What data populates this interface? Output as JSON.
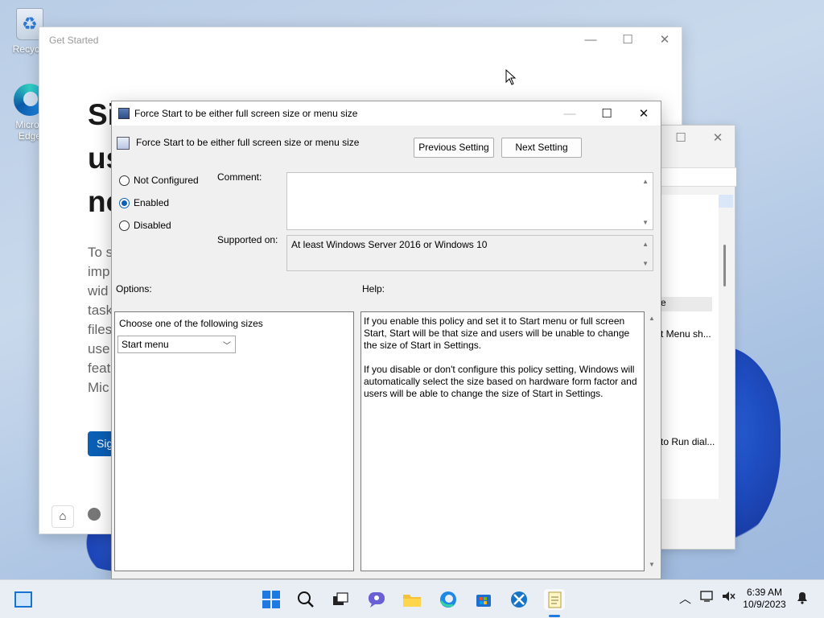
{
  "desktop": {
    "icons": [
      {
        "name": "recycle-bin",
        "label": "Recycle"
      },
      {
        "name": "edge",
        "label": "Micros\nEdge"
      }
    ]
  },
  "get_started": {
    "title": "Get Started",
    "heading_lines": [
      "Si",
      "us",
      "ne"
    ],
    "para_lines": [
      "To s",
      "imp",
      "wid",
      "task",
      "files",
      "use",
      "feat",
      "Mic"
    ],
    "sign_in_button": "Sig"
  },
  "back_window": {
    "rows": [
      "e",
      "t Menu sh...",
      "to Run dial..."
    ]
  },
  "dialog": {
    "window_title": "Force Start to be either full screen size or menu size",
    "header_title": "Force Start to be either full screen size or menu size",
    "previous_setting": "Previous Setting",
    "next_setting": "Next Setting",
    "radios": [
      {
        "label": "Not Configured",
        "checked": false
      },
      {
        "label": "Enabled",
        "checked": true
      },
      {
        "label": "Disabled",
        "checked": false
      }
    ],
    "comment_label": "Comment:",
    "comment_value": "",
    "supported_label": "Supported on:",
    "supported_value": "At least Windows Server 2016 or Windows 10",
    "options_label": "Options:",
    "help_label": "Help:",
    "options_prompt": "Choose one of the following sizes",
    "size_select_value": "Start menu",
    "help_paragraphs": [
      "If you enable this policy and set it to Start menu or full screen Start, Start will be that size and users will be unable to change the size of Start in Settings.",
      "If you disable or don't configure this policy setting, Windows will automatically select the size based on hardware form factor and users will be able to change the size of Start in Settings."
    ]
  },
  "taskbar": {
    "apps": [
      "widgets",
      "start",
      "search",
      "task-view",
      "chat",
      "file-explorer",
      "edge",
      "store",
      "snipping-tool",
      "notepad"
    ],
    "clock_time": "6:39 AM",
    "clock_date": "10/9/2023"
  },
  "colors": {
    "accent": "#0a5fb6",
    "taskbar": "#e9eef5",
    "dialog_bg": "#f0f0f0"
  }
}
